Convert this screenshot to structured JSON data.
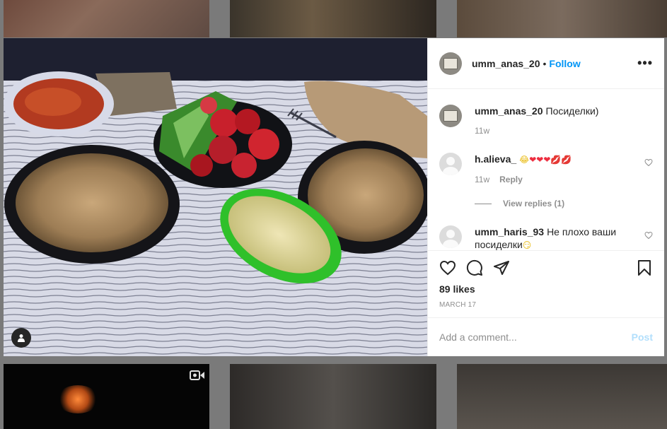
{
  "post": {
    "username": "umm_anas_20",
    "follow_label": "Follow",
    "dot": "•",
    "more_label": "•••",
    "caption": "Посиделки)",
    "caption_time": "11w",
    "likes": "89 likes",
    "date": "MARCH 17",
    "comment_placeholder": "Add a comment...",
    "post_label": "Post"
  },
  "comments": [
    {
      "username": "h.alieva_",
      "emoji": [
        "😂",
        "❤",
        "❤",
        "❤",
        "💋",
        "💋"
      ],
      "time": "11w",
      "reply_label": "Reply",
      "view_replies": "View replies (1)"
    },
    {
      "username": "umm_haris_93",
      "text": "Не плохо ваши посиделки",
      "emoji": "😏"
    }
  ],
  "icons": {
    "like": "heart-icon",
    "comment": "comment-icon",
    "share": "share-icon",
    "save": "bookmark-icon",
    "tag": "user-tag-icon",
    "video": "video-icon"
  },
  "colors": {
    "link_blue": "#0095f6",
    "post_disabled": "#b2dffc",
    "muted": "#8e8e8e",
    "text": "#262626"
  }
}
